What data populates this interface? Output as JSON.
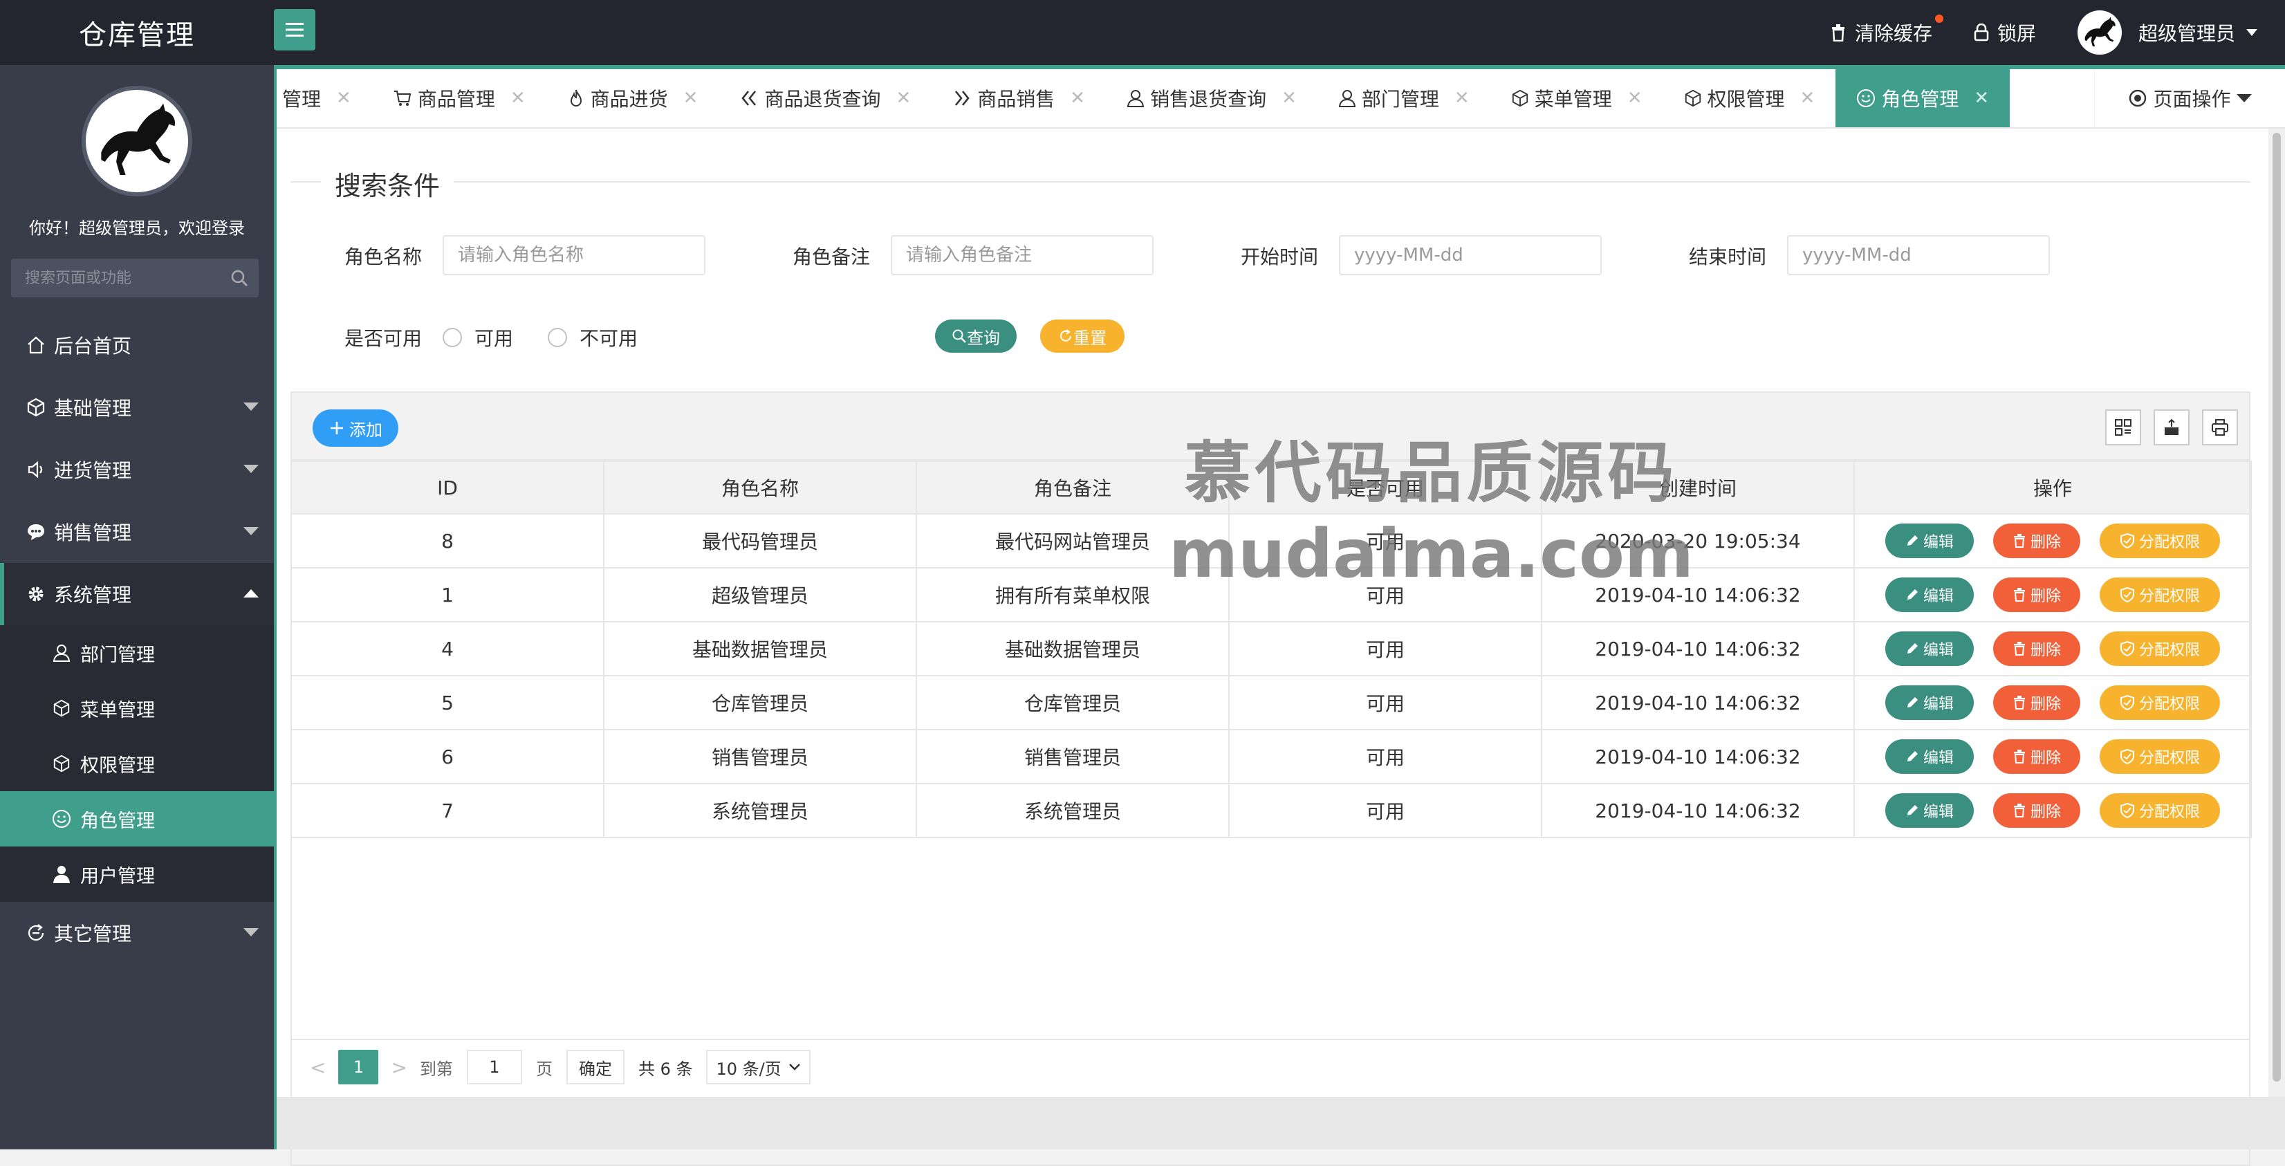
{
  "app": {
    "title": "仓库管理"
  },
  "header": {
    "clear_cache": "清除缓存",
    "lock_screen": "锁屏",
    "username": "超级管理员"
  },
  "sidebar": {
    "welcome": "你好！超级管理员，欢迎登录",
    "search_placeholder": "搜索页面或功能",
    "items": [
      {
        "label": "后台首页",
        "icon": "home-icon"
      },
      {
        "label": "基础管理",
        "icon": "cube-icon"
      },
      {
        "label": "进货管理",
        "icon": "speaker-icon"
      },
      {
        "label": "销售管理",
        "icon": "chat-icon"
      },
      {
        "label": "系统管理",
        "icon": "gear-icon"
      },
      {
        "label": "其它管理",
        "icon": "refresh-icon"
      }
    ],
    "subitems": [
      {
        "label": "部门管理",
        "icon": "user-icon"
      },
      {
        "label": "菜单管理",
        "icon": "cube-icon"
      },
      {
        "label": "权限管理",
        "icon": "cube-icon"
      },
      {
        "label": "角色管理",
        "icon": "smile-icon"
      },
      {
        "label": "用户管理",
        "icon": "person-icon"
      }
    ]
  },
  "tabs": [
    {
      "label": "管理"
    },
    {
      "label": "商品管理",
      "icon": "cart-icon"
    },
    {
      "label": "商品进货",
      "icon": "fire-icon"
    },
    {
      "label": "商品退货查询",
      "icon": "double-left-icon"
    },
    {
      "label": "商品销售",
      "icon": "double-right-icon"
    },
    {
      "label": "销售退货查询",
      "icon": "user-icon"
    },
    {
      "label": "部门管理",
      "icon": "user-icon"
    },
    {
      "label": "菜单管理",
      "icon": "cube-icon"
    },
    {
      "label": "权限管理",
      "icon": "cube-icon"
    },
    {
      "label": "角色管理",
      "icon": "smile-icon",
      "active": true
    }
  ],
  "page_ops": "页面操作",
  "search": {
    "legend": "搜索条件",
    "role_name_label": "角色名称",
    "role_name_placeholder": "请输入角色名称",
    "role_remark_label": "角色备注",
    "role_remark_placeholder": "请输入角色备注",
    "start_time_label": "开始时间",
    "start_time_placeholder": "yyyy-MM-dd",
    "end_time_label": "结束时间",
    "end_time_placeholder": "yyyy-MM-dd",
    "available_label": "是否可用",
    "radio_yes": "可用",
    "radio_no": "不可用",
    "query_button": "查询",
    "reset_button": "重置"
  },
  "toolbar": {
    "add_button": "添加"
  },
  "table": {
    "headers": [
      "ID",
      "角色名称",
      "角色备注",
      "是否可用",
      "创建时间",
      "操作"
    ],
    "rows": [
      {
        "id": "8",
        "name": "最代码管理员",
        "remark": "最代码网站管理员",
        "available": "可用",
        "created": "2020-03-20 19:05:34"
      },
      {
        "id": "1",
        "name": "超级管理员",
        "remark": "拥有所有菜单权限",
        "available": "可用",
        "created": "2019-04-10 14:06:32"
      },
      {
        "id": "4",
        "name": "基础数据管理员",
        "remark": "基础数据管理员",
        "available": "可用",
        "created": "2019-04-10 14:06:32"
      },
      {
        "id": "5",
        "name": "仓库管理员",
        "remark": "仓库管理员",
        "available": "可用",
        "created": "2019-04-10 14:06:32"
      },
      {
        "id": "6",
        "name": "销售管理员",
        "remark": "销售管理员",
        "available": "可用",
        "created": "2019-04-10 14:06:32"
      },
      {
        "id": "7",
        "name": "系统管理员",
        "remark": "系统管理员",
        "available": "可用",
        "created": "2019-04-10 14:06:32"
      }
    ],
    "op_edit": "编辑",
    "op_delete": "删除",
    "op_permission": "分配权限"
  },
  "pager": {
    "current": "1",
    "goto_label": "到第",
    "goto_value": "1",
    "page_unit": "页",
    "confirm": "确定",
    "total": "共 6 条",
    "page_size": "10 条/页"
  },
  "watermark": {
    "line1": "慕代码品质源码",
    "line2": "mudaima.com"
  },
  "colors": {
    "accent": "#3f9e8c",
    "sidebar": "#393d49",
    "header": "#23262e",
    "edit": "#3a8f80",
    "delete": "#f2603a",
    "permission": "#f7b32d",
    "add": "#2f9ef4"
  }
}
